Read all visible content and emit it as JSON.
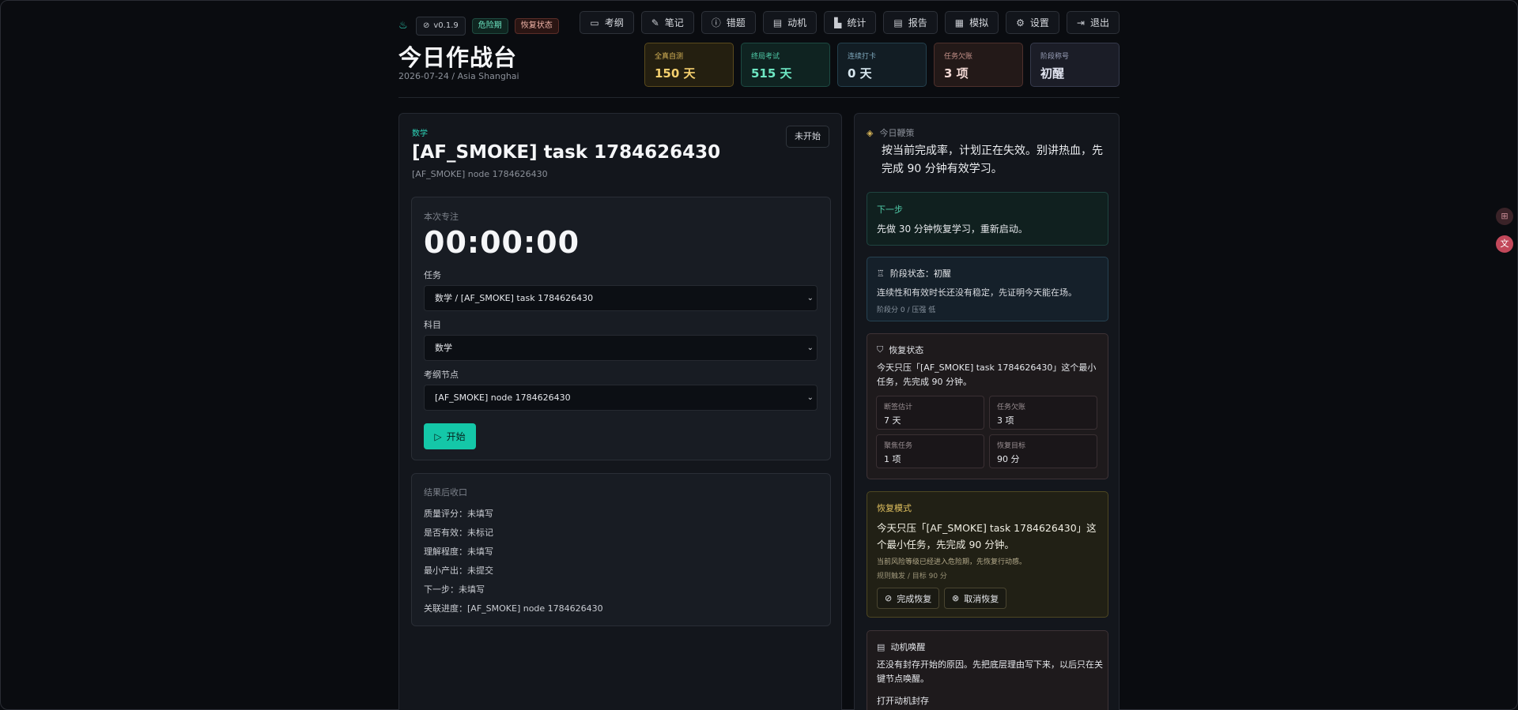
{
  "header": {
    "version": "v0.1.9",
    "badge_danger": "危险期",
    "badge_recover": "恢复状态",
    "title": "今日作战台",
    "date": "2026-07-24 / Asia Shanghai"
  },
  "nav": [
    {
      "label": "考纲",
      "icon": "book-icon"
    },
    {
      "label": "笔记",
      "icon": "edit-note-icon"
    },
    {
      "label": "错题",
      "icon": "alert-circle-icon"
    },
    {
      "label": "动机",
      "icon": "archive-icon"
    },
    {
      "label": "统计",
      "icon": "bar-chart-icon"
    },
    {
      "label": "报告",
      "icon": "document-icon"
    },
    {
      "label": "模拟",
      "icon": "calendar-icon"
    },
    {
      "label": "设置",
      "icon": "gear-icon"
    },
    {
      "label": "退出",
      "icon": "logout-icon"
    }
  ],
  "stats": [
    {
      "label": "全真自测",
      "value": "150 天"
    },
    {
      "label": "终局考试",
      "value": "515 天"
    },
    {
      "label": "连续打卡",
      "value": "0 天"
    },
    {
      "label": "任务欠账",
      "value": "3 项"
    },
    {
      "label": "阶段称号",
      "value": "初醒"
    }
  ],
  "task": {
    "subject": "数学",
    "title": "[AF_SMOKE] task 1784626430",
    "node": "[AF_SMOKE] node 1784626430",
    "status": "未开始"
  },
  "focus": {
    "label": "本次专注",
    "timer": "00:00:00",
    "task_label": "任务",
    "task_value": "数学 / [AF_SMOKE] task 1784626430",
    "subject_label": "科目",
    "subject_value": "数学",
    "node_label": "考纲节点",
    "node_value": "[AF_SMOKE] node 1784626430",
    "start_label": "开始"
  },
  "result": {
    "heading": "结果后收口",
    "rows": [
      "质量评分：未填写",
      "是否有效：未标记",
      "理解程度：未填写",
      "最小产出：未提交",
      "下一步：未填写",
      "关联进度：[AF_SMOKE] node 1784626430"
    ]
  },
  "whip": {
    "heading": "今日鞭策",
    "text": "按当前完成率，计划正在失效。别讲热血，先完成 90 分钟有效学习。"
  },
  "next_step": {
    "heading": "下一步",
    "text": "先做 30 分钟恢复学习，重新启动。"
  },
  "phase": {
    "heading": "阶段状态：初醒",
    "text": "连续性和有效时长还没有稳定，先证明今天能在场。",
    "sub": "阶段分 0 / 压强 低"
  },
  "recovery": {
    "heading": "恢复状态",
    "text": "今天只压「[AF_SMOKE] task 1784626430」这个最小任务，先完成 90 分钟。",
    "cells": [
      {
        "label": "断签估计",
        "value": "7 天"
      },
      {
        "label": "任务欠账",
        "value": "3 项"
      },
      {
        "label": "聚焦任务",
        "value": "1 项"
      },
      {
        "label": "恢复目标",
        "value": "90 分"
      }
    ]
  },
  "recovery_mode": {
    "heading": "恢复模式",
    "text": "今天只压「[AF_SMOKE] task 1784626430」这个最小任务，先完成 90 分钟。",
    "note": "当前风险等级已经进入危险期，先恢复行动感。",
    "rule": "规则触发 / 目标 90 分",
    "complete_label": "完成恢复",
    "cancel_label": "取消恢复"
  },
  "motive": {
    "heading": "动机唤醒",
    "text": "还没有封存开始的原因。先把底层理由写下来，以后只在关键节点唤醒。",
    "action": "打开动机封存"
  },
  "colors": {
    "accent": "#14c7a8",
    "warning": "#e1c15f",
    "background": "#0a0c10"
  }
}
